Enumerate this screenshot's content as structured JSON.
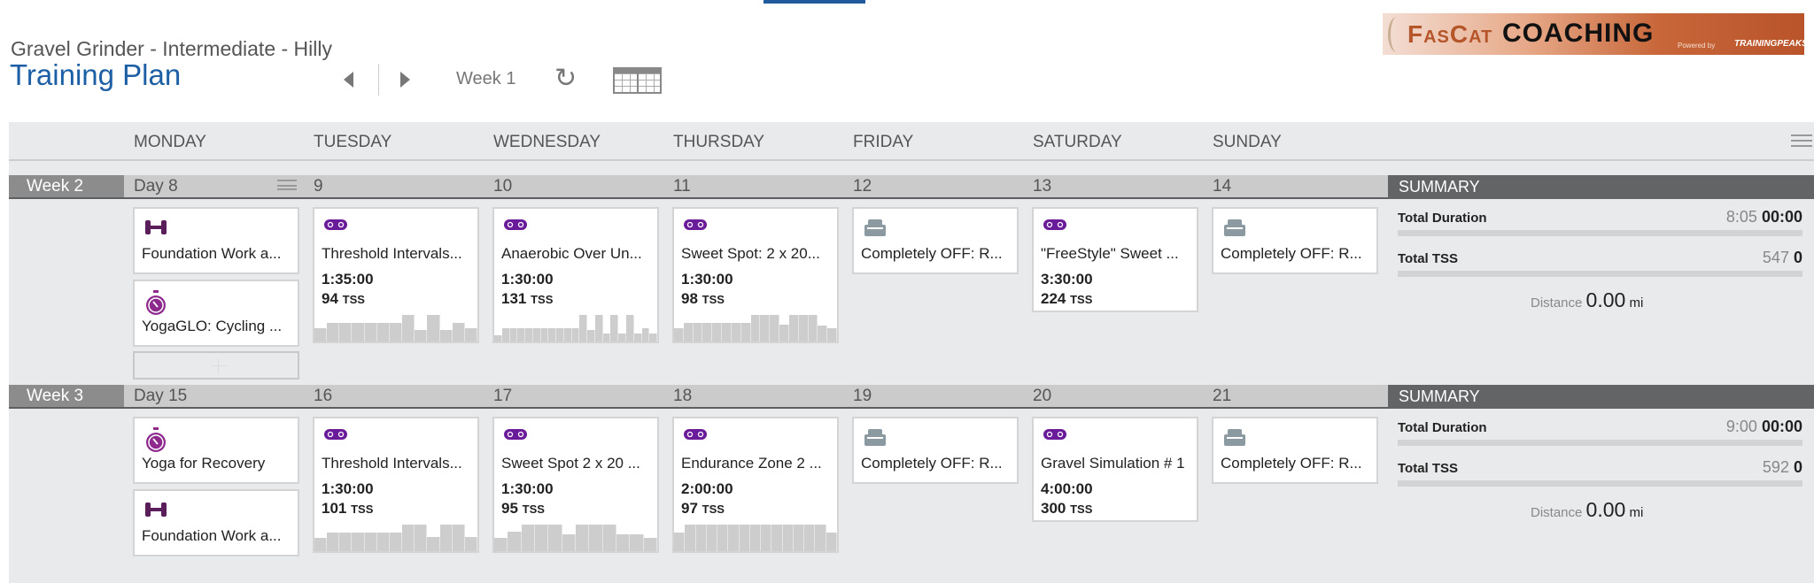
{
  "header": {
    "subtitle": "Gravel Grinder - Intermediate - Hilly",
    "title": "Training Plan",
    "week_label": "Week 1"
  },
  "logo": {
    "text": "FasCat COACHING",
    "powered": "Powered by",
    "brand": "TRAININGPEAKS"
  },
  "colors": {
    "title": "#1d5fa4",
    "bike": "#6a1b9a",
    "strength": "#5a1e5a",
    "yoga": "#8e2a8e",
    "off": "#8a9aa0",
    "summary_header": "#636466"
  },
  "days": [
    "MONDAY",
    "TUESDAY",
    "WEDNESDAY",
    "THURSDAY",
    "FRIDAY",
    "SATURDAY",
    "SUNDAY"
  ],
  "weeks": [
    {
      "label": "Week 2",
      "day_numbers": [
        "Day 8",
        "9",
        "10",
        "11",
        "12",
        "13",
        "14"
      ],
      "summary": {
        "header": "SUMMARY",
        "duration_label": "Total Duration",
        "duration_planned": "8:05",
        "duration_done": "00:00",
        "tss_label": "Total TSS",
        "tss_planned": "547",
        "tss_done": "0",
        "distance_label": "Distance",
        "distance_value": "0.00",
        "distance_unit": "mi"
      },
      "days": [
        [
          {
            "icon": "dumbbell-icon",
            "name": "Foundation Work a..."
          },
          {
            "icon": "stopwatch-icon",
            "name": "YogaGLO: Cycling ..."
          }
        ],
        [
          {
            "icon": "bike-icon",
            "name": "Threshold Intervals...",
            "duration": "1:35:00",
            "tss": "94",
            "tss_unit": "TSS",
            "profile": [
              0.5,
              0.7,
              0.7,
              0.7,
              0.7,
              0.7,
              0.7,
              1,
              0.45,
              1,
              0.45,
              0.7,
              0.5
            ]
          }
        ],
        [
          {
            "icon": "bike-icon",
            "name": "Anaerobic Over Un...",
            "duration": "1:30:00",
            "tss": "131",
            "tss_unit": "TSS",
            "profile": [
              0.25,
              0.5,
              0.5,
              0.5,
              0.5,
              0.5,
              0.5,
              0.5,
              0.5,
              0.5,
              0.5,
              1,
              0.45,
              1,
              0.3,
              1,
              0.3,
              1,
              0.3,
              0.5,
              0.3
            ]
          }
        ],
        [
          {
            "icon": "bike-icon",
            "name": "Sweet Spot: 2 x 20...",
            "duration": "1:30:00",
            "tss": "98",
            "tss_unit": "TSS",
            "profile": [
              0.5,
              0.7,
              0.7,
              0.7,
              0.7,
              0.7,
              0.7,
              0.7,
              1,
              1,
              1,
              0.65,
              1,
              1,
              1,
              0.6,
              0.5
            ]
          }
        ],
        [
          {
            "icon": "couch-icon",
            "name": "Completely OFF: R..."
          }
        ],
        [
          {
            "icon": "bike-icon",
            "name": "\"FreeStyle\" Sweet ...",
            "duration": "3:30:00",
            "tss": "224",
            "tss_unit": "TSS"
          }
        ],
        [
          {
            "icon": "couch-icon",
            "name": "Completely OFF: R..."
          }
        ]
      ]
    },
    {
      "label": "Week 3",
      "day_numbers": [
        "Day 15",
        "16",
        "17",
        "18",
        "19",
        "20",
        "21"
      ],
      "summary": {
        "header": "SUMMARY",
        "duration_label": "Total Duration",
        "duration_planned": "9:00",
        "duration_done": "00:00",
        "tss_label": "Total TSS",
        "tss_planned": "592",
        "tss_done": "0",
        "distance_label": "Distance",
        "distance_value": "0.00",
        "distance_unit": "mi"
      },
      "days": [
        [
          {
            "icon": "stopwatch-icon",
            "name": "Yoga for Recovery"
          },
          {
            "icon": "dumbbell-icon",
            "name": "Foundation Work a..."
          }
        ],
        [
          {
            "icon": "bike-icon",
            "name": "Threshold Intervals...",
            "duration": "1:30:00",
            "tss": "101",
            "tss_unit": "TSS",
            "profile": [
              0.5,
              0.7,
              0.7,
              0.7,
              0.7,
              0.7,
              0.7,
              1,
              1,
              0.55,
              1,
              1,
              0.55
            ]
          }
        ],
        [
          {
            "icon": "bike-icon",
            "name": "Sweet Spot 2 x 20 ...",
            "duration": "1:30:00",
            "tss": "95",
            "tss_unit": "TSS",
            "profile": [
              0.5,
              0.75,
              1,
              1,
              1,
              0.65,
              1,
              1,
              1,
              0.65,
              0.65,
              0.5
            ]
          }
        ],
        [
          {
            "icon": "bike-icon",
            "name": "Endurance Zone 2 ...",
            "duration": "2:00:00",
            "tss": "97",
            "tss_unit": "TSS",
            "profile": [
              0.7,
              1,
              1,
              1,
              1,
              1,
              1,
              1,
              1,
              1,
              1,
              1,
              1,
              1,
              0.7
            ]
          }
        ],
        [
          {
            "icon": "couch-icon",
            "name": "Completely OFF: R..."
          }
        ],
        [
          {
            "icon": "bike-icon",
            "name": "Gravel Simulation # 1",
            "duration": "4:00:00",
            "tss": "300",
            "tss_unit": "TSS"
          }
        ],
        [
          {
            "icon": "couch-icon",
            "name": "Completely OFF: R..."
          }
        ]
      ]
    }
  ]
}
